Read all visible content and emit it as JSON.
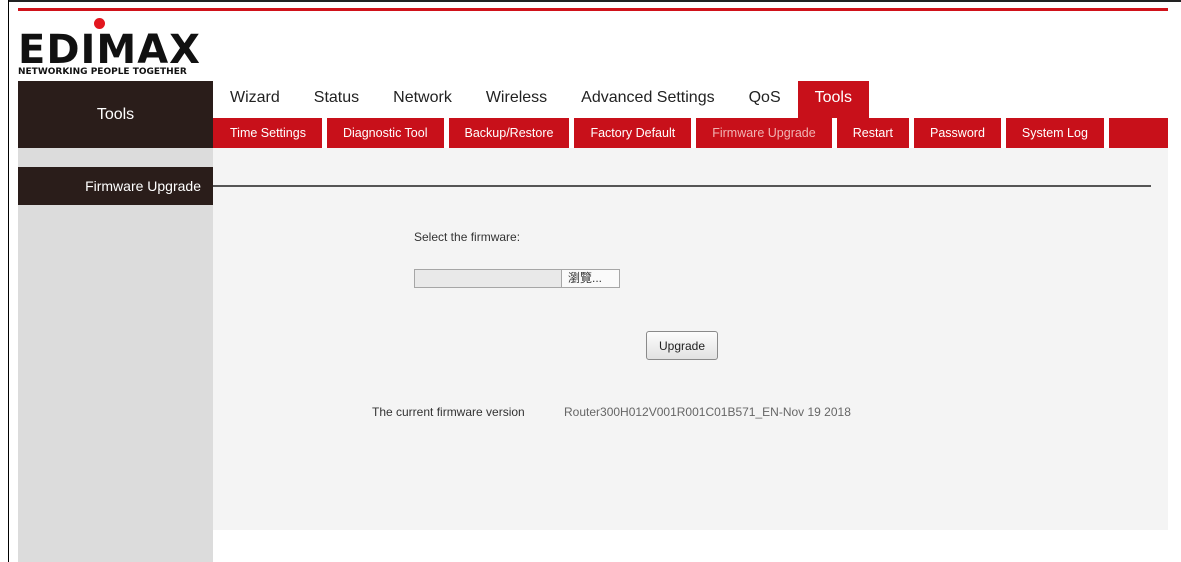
{
  "brand": {
    "logo_text": "EDIMAX",
    "tagline": "NETWORKING PEOPLE TOGETHER",
    "accent_color": "#c8101a",
    "dark_color": "#2a1d1a"
  },
  "sidebar": {
    "title": "Tools",
    "items": [
      {
        "label": "Firmware Upgrade",
        "active": true
      }
    ]
  },
  "top_nav": {
    "tabs": [
      {
        "label": "Wizard",
        "active": false
      },
      {
        "label": "Status",
        "active": false
      },
      {
        "label": "Network",
        "active": false
      },
      {
        "label": "Wireless",
        "active": false
      },
      {
        "label": "Advanced Settings",
        "active": false
      },
      {
        "label": "QoS",
        "active": false
      },
      {
        "label": "Tools",
        "active": true
      }
    ]
  },
  "sub_nav": {
    "items": [
      {
        "label": "Time Settings",
        "active": false
      },
      {
        "label": "Diagnostic Tool",
        "active": false
      },
      {
        "label": "Backup/Restore",
        "active": false
      },
      {
        "label": "Factory Default",
        "active": false
      },
      {
        "label": "Firmware Upgrade",
        "active": true
      },
      {
        "label": "Restart",
        "active": false
      },
      {
        "label": "Password",
        "active": false
      },
      {
        "label": "System Log",
        "active": false
      }
    ]
  },
  "main": {
    "select_label": "Select the firmware:",
    "file_input": {
      "value": "",
      "browse_label": "瀏覽..."
    },
    "upgrade_button": "Upgrade",
    "current_version_label": "The current firmware version",
    "current_version_value": "Router300H012V001R001C01B571_EN-Nov 19 2018"
  }
}
